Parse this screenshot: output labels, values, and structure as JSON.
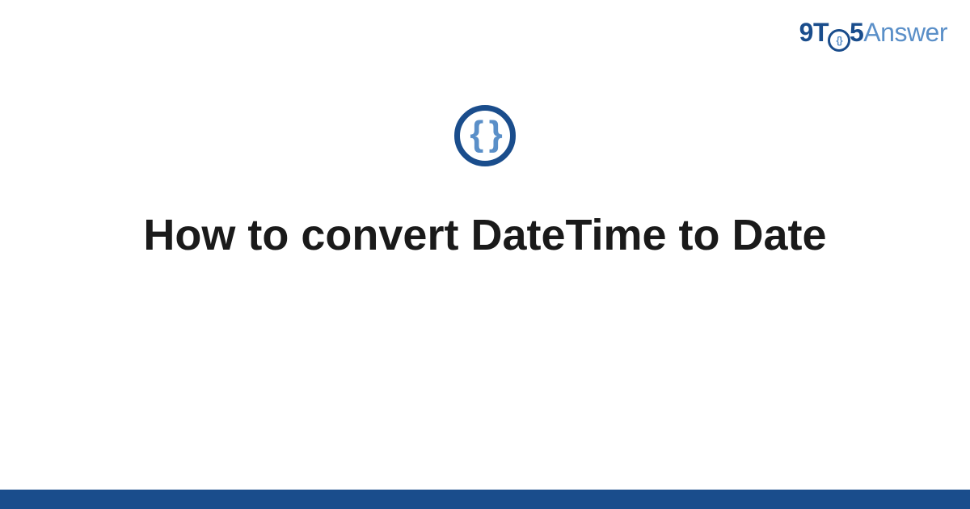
{
  "brand": {
    "prefix": "9T",
    "num5": "5",
    "suffix": "Answer"
  },
  "icon": {
    "braces": "{ }"
  },
  "title": "How to convert DateTime to Date"
}
